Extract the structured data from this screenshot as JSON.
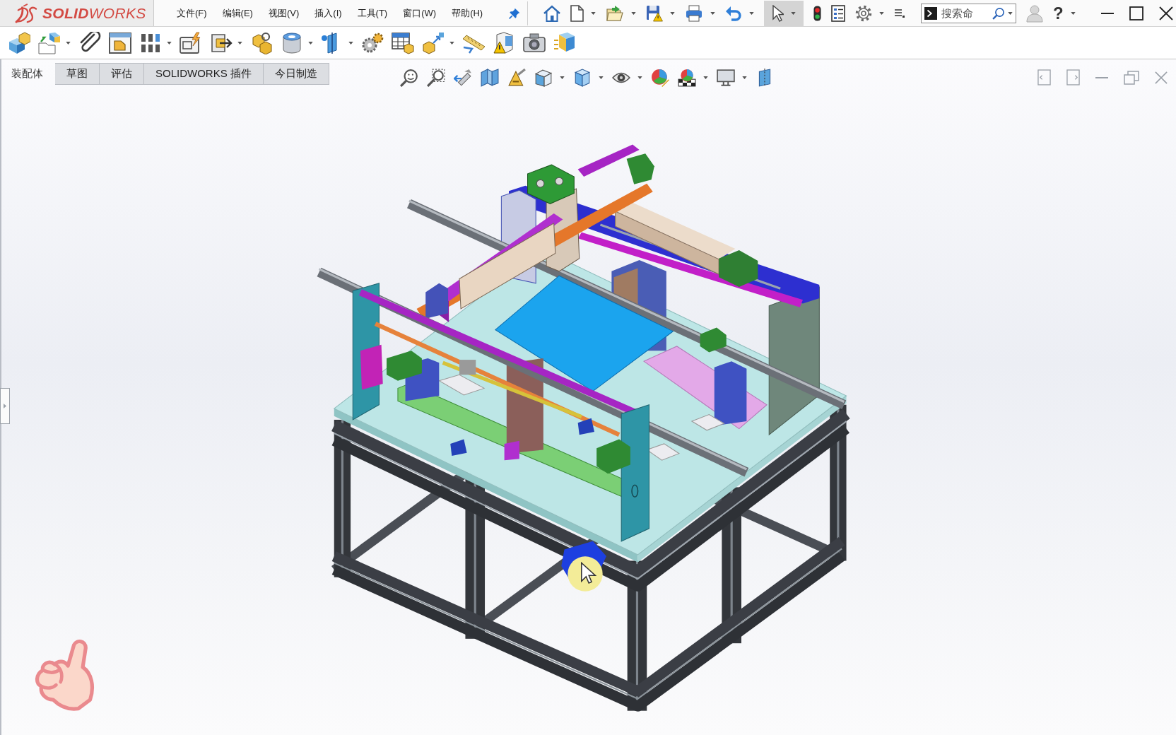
{
  "app": {
    "logo": "**SOLID**WORKS"
  },
  "menu": [
    "文件(F)",
    "编辑(E)",
    "视图(V)",
    "插入(I)",
    "工具(T)",
    "窗口(W)",
    "帮助(H)"
  ],
  "quick_access": {
    "select_active": true
  },
  "search": {
    "placeholder": "搜索命"
  },
  "help": {
    "label": "?"
  },
  "tabs": [
    {
      "label": "装配体",
      "selected": true
    },
    {
      "label": "草图",
      "selected": false
    },
    {
      "label": "评估",
      "selected": false
    },
    {
      "label": "SOLIDWORKS 插件",
      "selected": false
    },
    {
      "label": "今日制造",
      "selected": false
    }
  ]
}
